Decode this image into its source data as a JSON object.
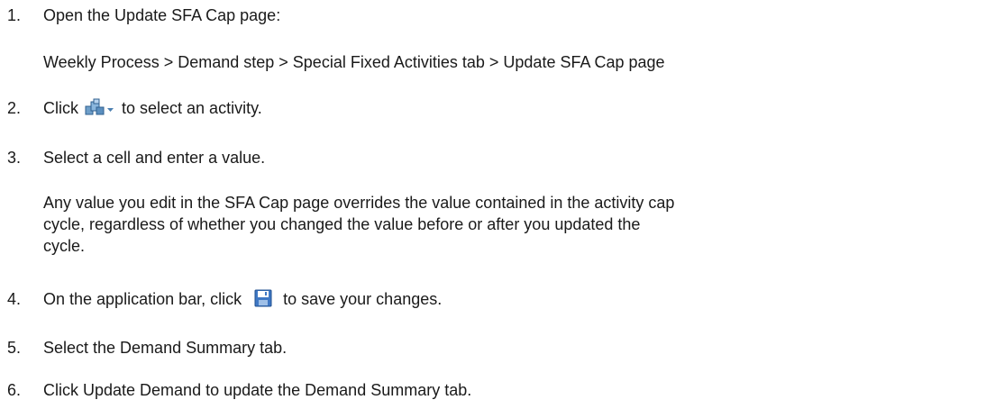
{
  "steps": [
    {
      "number": "1.",
      "text": "Open the Update SFA Cap page:",
      "detail": "Weekly Process > Demand step > Special Fixed Activities tab > Update SFA Cap page"
    },
    {
      "number": "2.",
      "before": "Click",
      "icon": "activity-selector-icon",
      "after": "to select an activity."
    },
    {
      "number": "3.",
      "text": "Select a cell and enter a value.",
      "note_lines": [
        "Any value you edit in the SFA Cap page overrides the value contained in the activity cap",
        "cycle, regardless of whether you changed the value before or after you updated the",
        "cycle."
      ]
    },
    {
      "number": "4.",
      "before": "On the application bar, click",
      "icon": "save-icon",
      "after": "to save your changes."
    },
    {
      "number": "5.",
      "text": "Select the Demand Summary tab."
    },
    {
      "number": "6.",
      "text": "Click Update Demand to update the Demand Summary tab."
    }
  ]
}
